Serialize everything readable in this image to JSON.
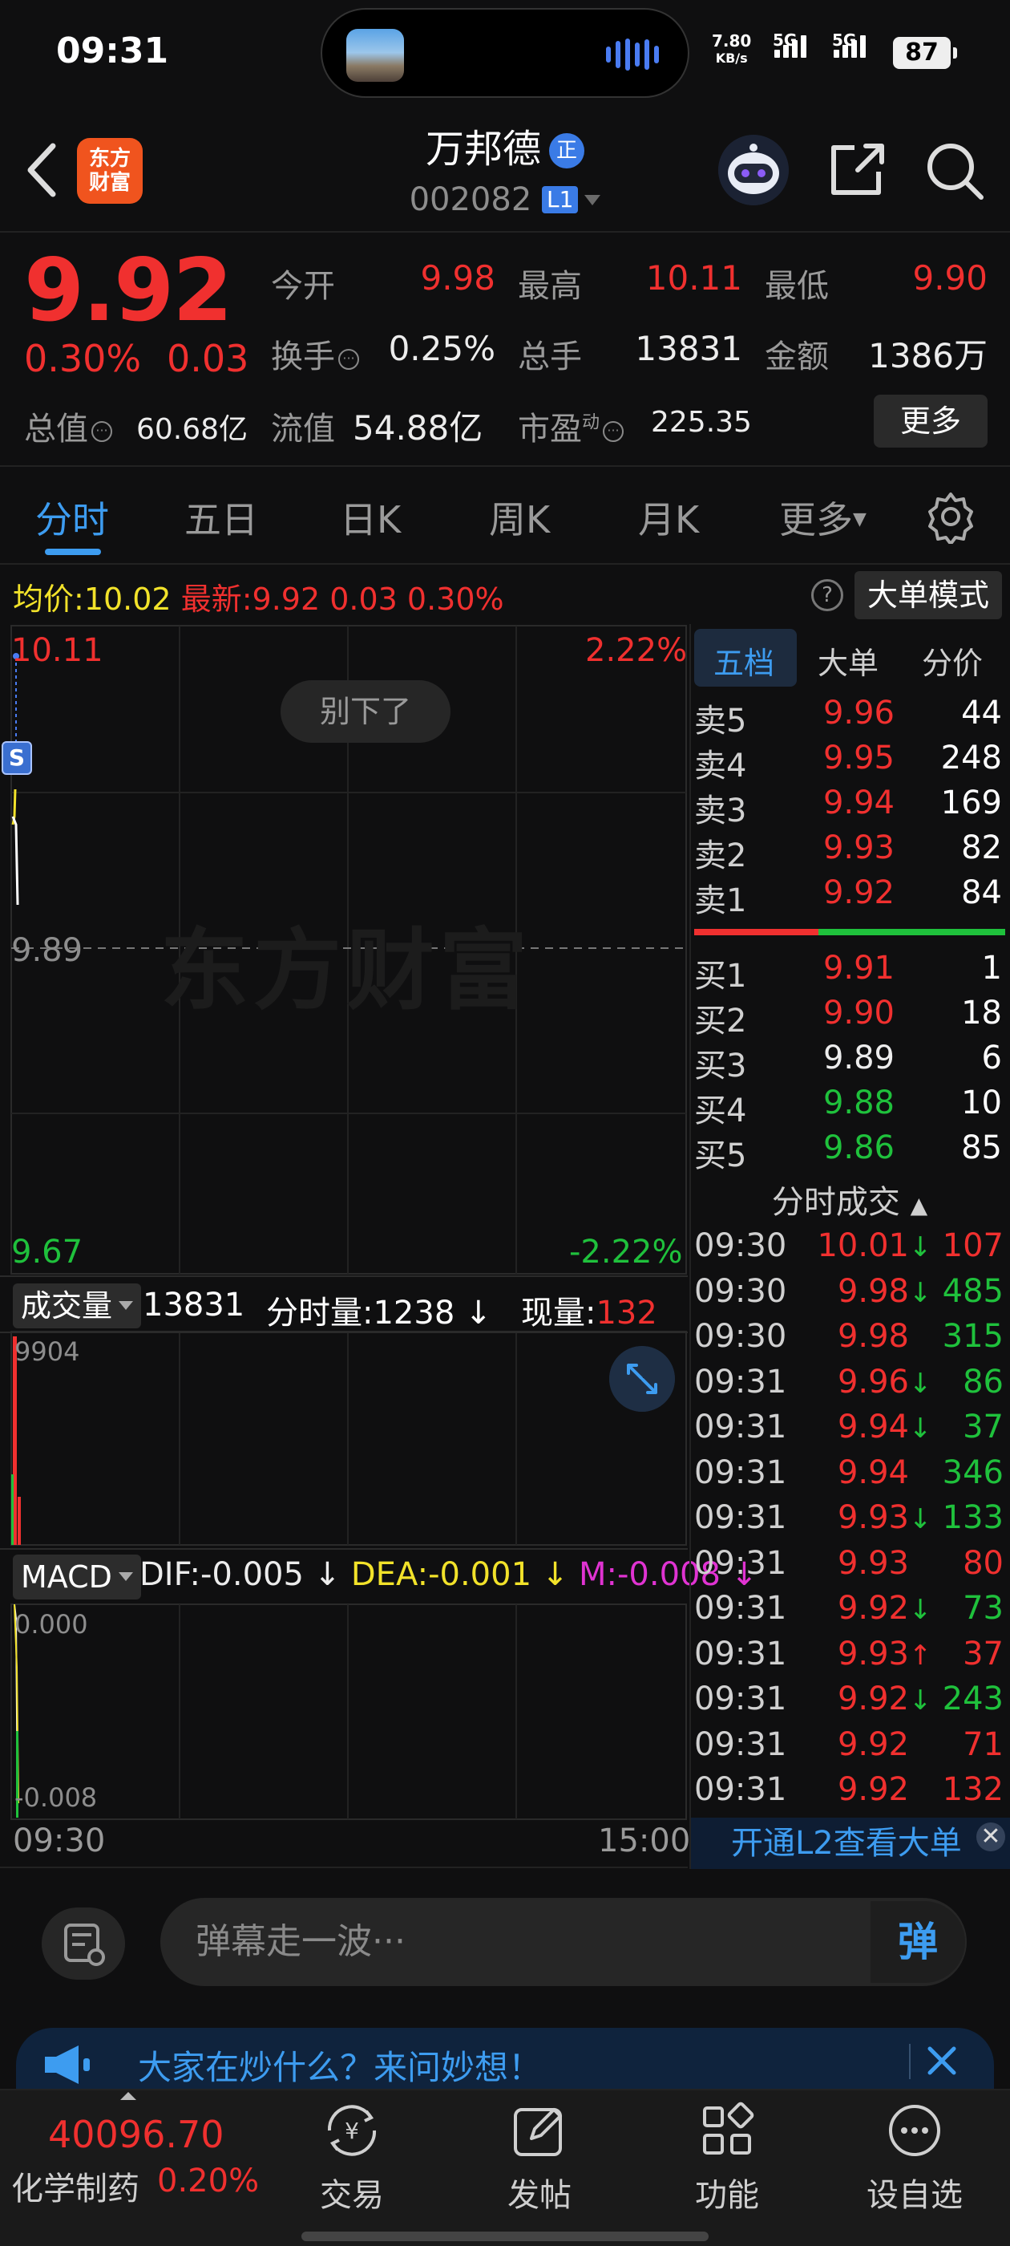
{
  "status_bar": {
    "time": "09:31",
    "net_speed_value": "7.80",
    "net_speed_unit": "KB/s",
    "signal1_label": "5G",
    "signal2_label": "5G",
    "battery": "87"
  },
  "header": {
    "logo_line1": "东方",
    "logo_line2": "财富",
    "stock_name": "万邦德",
    "badge": "正",
    "stock_code": "002082",
    "level_tag": "L1"
  },
  "quote": {
    "price": "9.92",
    "change_pct": "0.30%",
    "change": "0.03",
    "open_label": "今开",
    "open": "9.98",
    "high_label": "最高",
    "high": "10.11",
    "low_label": "最低",
    "low": "9.90",
    "turnover_label": "换手",
    "turnover": "0.25%",
    "volume_label": "总手",
    "volume": "13831",
    "amount_label": "金额",
    "amount": "1386万",
    "mktcap_label": "总值",
    "mktcap": "60.68亿",
    "float_label": "流值",
    "float_value": "54.88亿",
    "pe_label": "市盈",
    "pe_sup": "动",
    "pe": "225.35",
    "more_button": "更多"
  },
  "tabs": [
    {
      "label": "分时",
      "active": true
    },
    {
      "label": "五日"
    },
    {
      "label": "日K"
    },
    {
      "label": "周K"
    },
    {
      "label": "月K"
    },
    {
      "label": "更多"
    }
  ],
  "info_line": {
    "avg_label": "均价:",
    "avg": "10.02",
    "latest_label": "最新:",
    "latest": "9.92",
    "latest_chg": "0.03",
    "latest_pct": "0.30%",
    "help": "?",
    "big_mode": "大单模式"
  },
  "intraday": {
    "y_top": "10.11",
    "y_mid": "9.89",
    "y_bottom": "9.67",
    "pct_top": "2.22%",
    "pct_bottom": "-2.22%",
    "marker": "S",
    "toast": "别下了",
    "watermark": "东方财富"
  },
  "volume_panel": {
    "selector": "成交量",
    "total": "13831",
    "minute_vol": "分时量:1238 ↓",
    "now_label": "现量:",
    "now_value": "132",
    "max": "9904"
  },
  "macd_panel": {
    "selector": "MACD",
    "dif": "DIF:-0.005 ↓",
    "dea": "DEA:-0.001 ↓",
    "m": "M:-0.008 ↓",
    "top": "0.000",
    "bottom": "-0.008"
  },
  "time_axis": {
    "start": "09:30",
    "end": "15:00"
  },
  "right_tabs": [
    "五档",
    "大单",
    "分价"
  ],
  "order_book": {
    "asks": [
      {
        "name": "卖5",
        "price": "9.96",
        "vol": "44",
        "color": "red"
      },
      {
        "name": "卖4",
        "price": "9.95",
        "vol": "248",
        "color": "red"
      },
      {
        "name": "卖3",
        "price": "9.94",
        "vol": "169",
        "color": "red"
      },
      {
        "name": "卖2",
        "price": "9.93",
        "vol": "82",
        "color": "red"
      },
      {
        "name": "卖1",
        "price": "9.92",
        "vol": "84",
        "color": "red"
      }
    ],
    "bids": [
      {
        "name": "买1",
        "price": "9.91",
        "vol": "1",
        "color": "red"
      },
      {
        "name": "买2",
        "price": "9.90",
        "vol": "18",
        "color": "red"
      },
      {
        "name": "买3",
        "price": "9.89",
        "vol": "6",
        "color": "white"
      },
      {
        "name": "买4",
        "price": "9.88",
        "vol": "10",
        "color": "green"
      },
      {
        "name": "买5",
        "price": "9.86",
        "vol": "85",
        "color": "green"
      }
    ]
  },
  "trades_title": "分时成交",
  "trades": [
    {
      "time": "09:30",
      "price": "10.01",
      "dir": "↓",
      "vol": "107",
      "vol_color": "red"
    },
    {
      "time": "09:30",
      "price": "9.98",
      "dir": "↓",
      "vol": "485",
      "vol_color": "green"
    },
    {
      "time": "09:30",
      "price": "9.98",
      "dir": "",
      "vol": "315",
      "vol_color": "green"
    },
    {
      "time": "09:31",
      "price": "9.96",
      "dir": "↓",
      "vol": "86",
      "vol_color": "green"
    },
    {
      "time": "09:31",
      "price": "9.94",
      "dir": "↓",
      "vol": "37",
      "vol_color": "green"
    },
    {
      "time": "09:31",
      "price": "9.94",
      "dir": "",
      "vol": "346",
      "vol_color": "green"
    },
    {
      "time": "09:31",
      "price": "9.93",
      "dir": "↓",
      "vol": "133",
      "vol_color": "green"
    },
    {
      "time": "09:31",
      "price": "9.93",
      "dir": "",
      "vol": "80",
      "vol_color": "red"
    },
    {
      "time": "09:31",
      "price": "9.92",
      "dir": "↓",
      "vol": "73",
      "vol_color": "green"
    },
    {
      "time": "09:31",
      "price": "9.93",
      "dir": "↑",
      "vol": "37",
      "vol_color": "red"
    },
    {
      "time": "09:31",
      "price": "9.92",
      "dir": "↓",
      "vol": "243",
      "vol_color": "green"
    },
    {
      "time": "09:31",
      "price": "9.92",
      "dir": "",
      "vol": "71",
      "vol_color": "red"
    },
    {
      "time": "09:31",
      "price": "9.92",
      "dir": "",
      "vol": "132",
      "vol_color": "red"
    }
  ],
  "l2_banner": "开通L2查看大单",
  "danmu": {
    "placeholder": "弹幕走一波···",
    "send": "弹"
  },
  "banner": {
    "text": "大家在炒什么？来问妙想！"
  },
  "bottom_nav": {
    "index_value": "40096.70",
    "index_name": "化学制药",
    "index_pct": "0.20%",
    "items": [
      "交易",
      "发帖",
      "功能",
      "设自选"
    ]
  },
  "colors": {
    "up": "#f0302f",
    "down": "#1fc13c",
    "accent": "#3d9cf0",
    "avg_line": "#f2e22a"
  }
}
